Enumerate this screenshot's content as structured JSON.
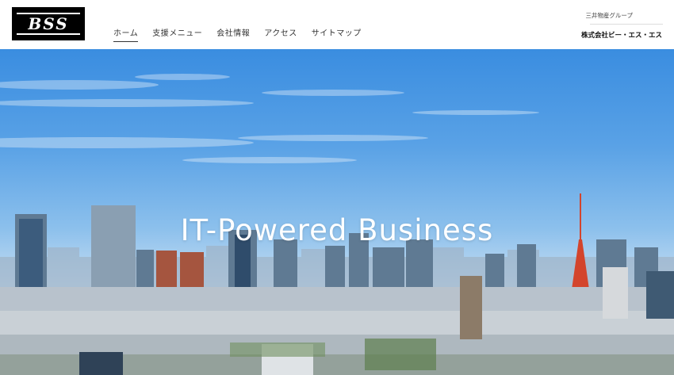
{
  "logo": {
    "text": "BSS"
  },
  "nav": {
    "items": [
      {
        "label": "ホーム"
      },
      {
        "label": "支援メニュー"
      },
      {
        "label": "会社情報"
      },
      {
        "label": "アクセス"
      },
      {
        "label": "サイトマップ"
      }
    ],
    "active": "ホーム"
  },
  "corporate": {
    "group_label": "三井物産グループ",
    "company_name": "株式会社ビー・エス・エス"
  },
  "hero": {
    "title": "IT-Powered Business"
  },
  "colors": {
    "sky_top": "#3a8de0",
    "sky_bottom": "#e6eef5",
    "text_dark": "#333333",
    "logo_bg": "#000000"
  }
}
